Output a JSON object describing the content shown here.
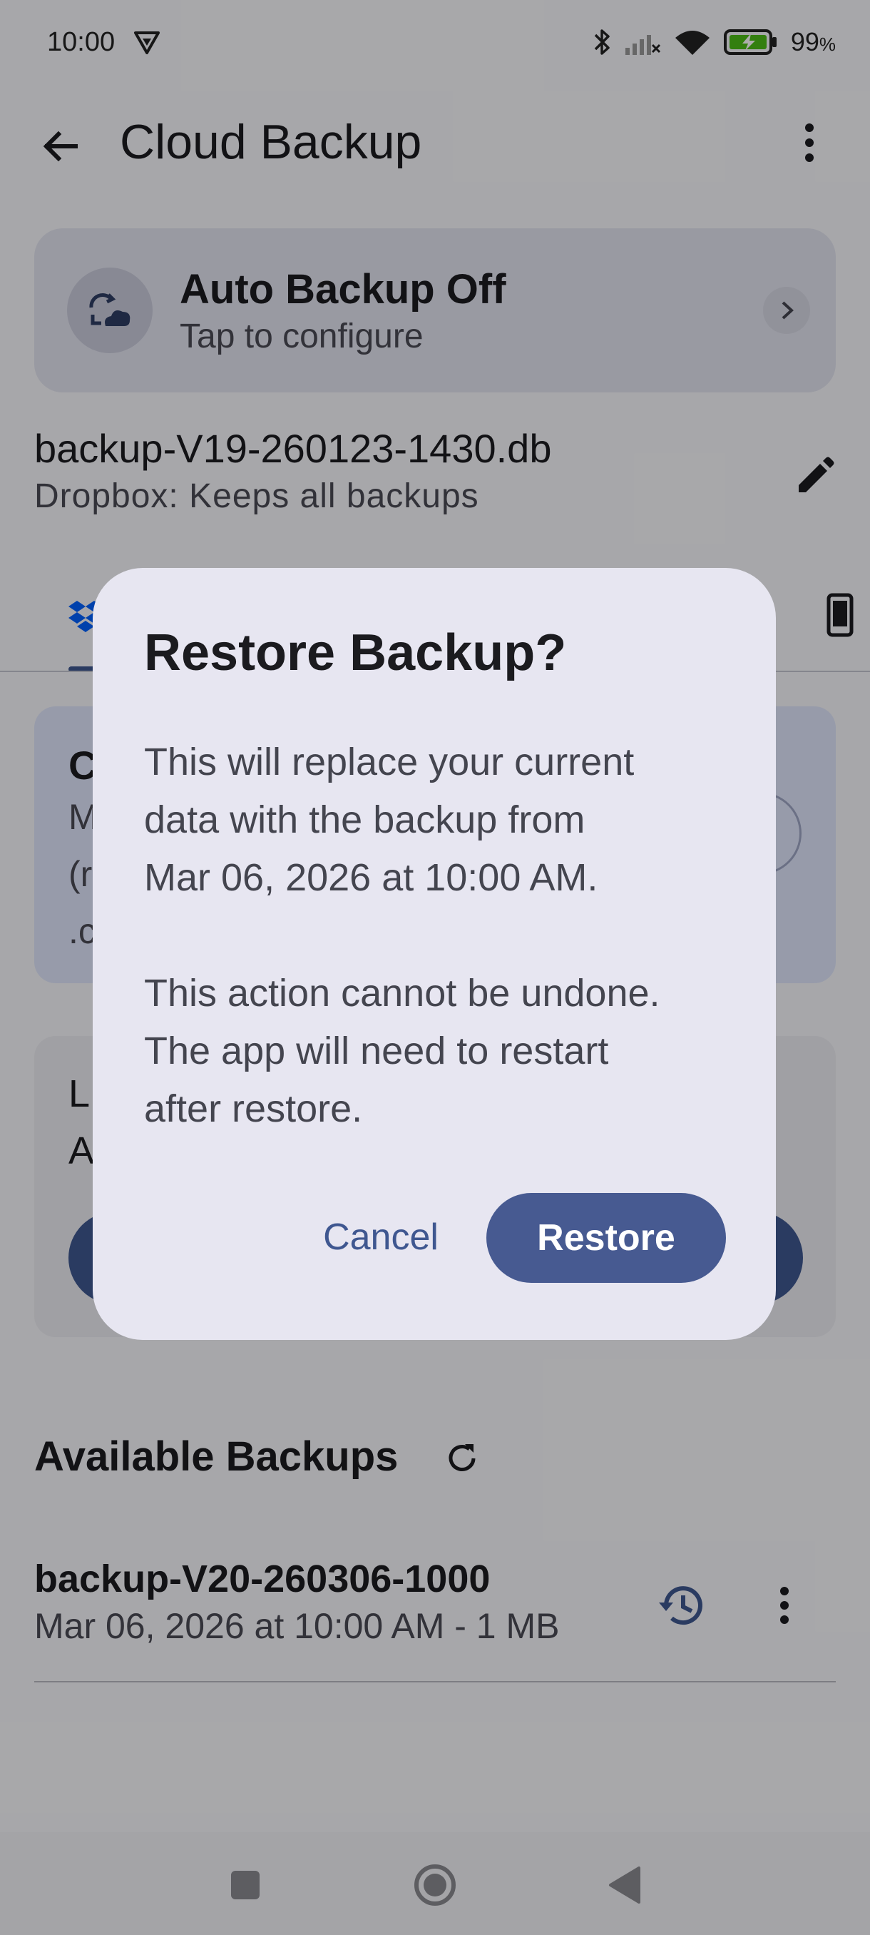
{
  "status_bar": {
    "time": "10:00",
    "battery_percent": "99",
    "battery_unit": "%"
  },
  "app_bar": {
    "title": "Cloud Backup",
    "back_icon": "arrow-back-icon",
    "menu_icon": "more-vert-icon"
  },
  "auto_backup": {
    "title": "Auto Backup Off",
    "subtitle": "Tap to configure",
    "icon": "cloud-sync-icon"
  },
  "current_file": {
    "name": "backup-V19-260123-1430.db",
    "provider_note": "Dropbox: Keeps all backups",
    "edit_icon": "edit-icon"
  },
  "background_cards": {
    "blue_card_lines": [
      "C",
      "M",
      "(r",
      ".c"
    ],
    "gray_card_lines": [
      "L",
      "A"
    ]
  },
  "available_backups": {
    "title": "Available Backups",
    "items": [
      {
        "name": "backup-V20-260306-1000",
        "details": "Mar 06, 2026 at 10:00 AM - 1 MB"
      }
    ]
  },
  "dialog": {
    "title": "Restore Backup?",
    "body_line_1": "This will replace your current",
    "body_line_2": "data with the backup from",
    "body_line_3": "Mar 06, 2026 at 10:00 AM.",
    "body_line_4": "This action cannot be undone.",
    "body_line_5": "The app will need to restart",
    "body_line_6": "after restore.",
    "cancel_label": "Cancel",
    "restore_label": "Restore"
  },
  "colors": {
    "accent": "#3f5790",
    "dialog_bg": "#e7e6f1",
    "scrim": "rgba(0,0,0,0.32)"
  }
}
